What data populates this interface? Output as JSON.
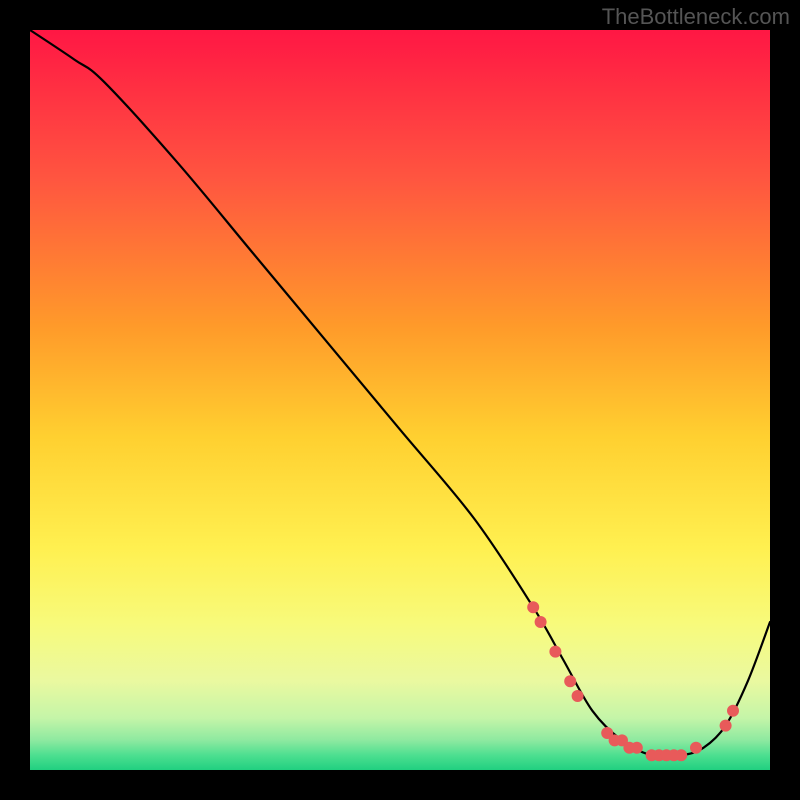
{
  "watermark": "TheBottleneck.com",
  "chart_data": {
    "type": "line",
    "title": "",
    "xlabel": "",
    "ylabel": "",
    "xlim": [
      0,
      100
    ],
    "ylim": [
      0,
      100
    ],
    "gradient_stops": [
      {
        "offset": 0,
        "color": "#ff1744"
      },
      {
        "offset": 20,
        "color": "#ff5540"
      },
      {
        "offset": 40,
        "color": "#ff9a2a"
      },
      {
        "offset": 55,
        "color": "#ffd030"
      },
      {
        "offset": 70,
        "color": "#fff050"
      },
      {
        "offset": 80,
        "color": "#f8fa7a"
      },
      {
        "offset": 88,
        "color": "#eaf9a0"
      },
      {
        "offset": 93,
        "color": "#c4f5a8"
      },
      {
        "offset": 96,
        "color": "#8de9a0"
      },
      {
        "offset": 98,
        "color": "#4ddf90"
      },
      {
        "offset": 100,
        "color": "#20d080"
      }
    ],
    "series": [
      {
        "name": "curve",
        "x": [
          0,
          6,
          10,
          20,
          30,
          40,
          50,
          60,
          68,
          72,
          76,
          80,
          84,
          88,
          91,
          94,
          97,
          100
        ],
        "values": [
          100,
          96,
          93,
          82,
          70,
          58,
          46,
          34,
          22,
          15,
          8,
          4,
          2,
          2,
          3,
          6,
          12,
          20
        ]
      }
    ],
    "markers": {
      "name": "highlight-points",
      "color": "#e85a5a",
      "x": [
        68,
        69,
        71,
        73,
        74,
        78,
        79,
        80,
        81,
        82,
        84,
        85,
        86,
        87,
        88,
        90,
        94,
        95
      ],
      "values": [
        22,
        20,
        16,
        12,
        10,
        5,
        4,
        4,
        3,
        3,
        2,
        2,
        2,
        2,
        2,
        3,
        6,
        8
      ]
    }
  }
}
